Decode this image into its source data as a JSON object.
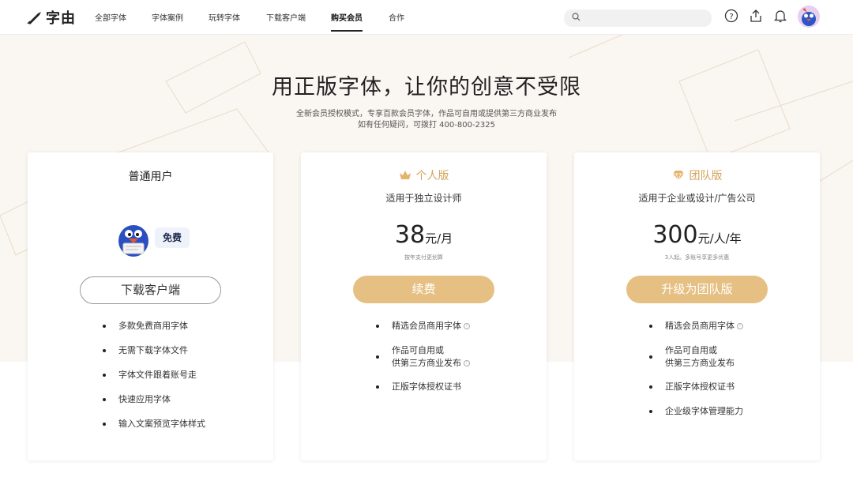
{
  "brand": {
    "name": "字由"
  },
  "nav": {
    "items": [
      "全部字体",
      "字体案例",
      "玩转字体",
      "下载客户端",
      "购买会员",
      "合作"
    ],
    "active": "购买会员"
  },
  "search": {
    "placeholder": ""
  },
  "icons": [
    "help-icon",
    "upload-icon",
    "bell-icon",
    "avatar"
  ],
  "hero": {
    "title": "用正版字体，让你的创意不受限",
    "line1": "全新会员授权模式，专享百款会员字体，作品可自用或提供第三方商业发布",
    "line2": "如有任何疑问，可拨打 400-800-2325"
  },
  "cards": [
    {
      "title": "普通用户",
      "badge": "免费",
      "button": "下载客户端",
      "features": [
        "多款免费商用字体",
        "无需下载字体文件",
        "字体文件跟着账号走",
        "快速应用字体",
        "输入文案预览字体样式"
      ]
    },
    {
      "title": "个人版",
      "desc": "适用于独立设计师",
      "price": "38",
      "unit": "元/月",
      "note": "按年支付更划算",
      "button": "续费",
      "features": [
        {
          "line1": "精选会员商用字体",
          "info": true
        },
        {
          "line1": "作品可自用或",
          "line2": "供第三方商业发布",
          "info": true
        },
        {
          "line1": "正版字体授权证书"
        }
      ]
    },
    {
      "title": "团队版",
      "desc": "适用于企业或设计/广告公司",
      "price": "300",
      "unit": "元/人/年",
      "note": "3人起。多账号享更多优惠",
      "button": "升级为团队版",
      "features": [
        {
          "line1": "精选会员商用字体",
          "info": true
        },
        {
          "line1": "作品可自用或",
          "line2": "供第三方商业发布"
        },
        {
          "line1": "正版字体授权证书"
        },
        {
          "line1": "企业级字体管理能力"
        }
      ]
    }
  ],
  "colors": {
    "gold": "#e6c083",
    "gold_text": "#d4a25a",
    "hero_bg": "#faf6f1"
  }
}
